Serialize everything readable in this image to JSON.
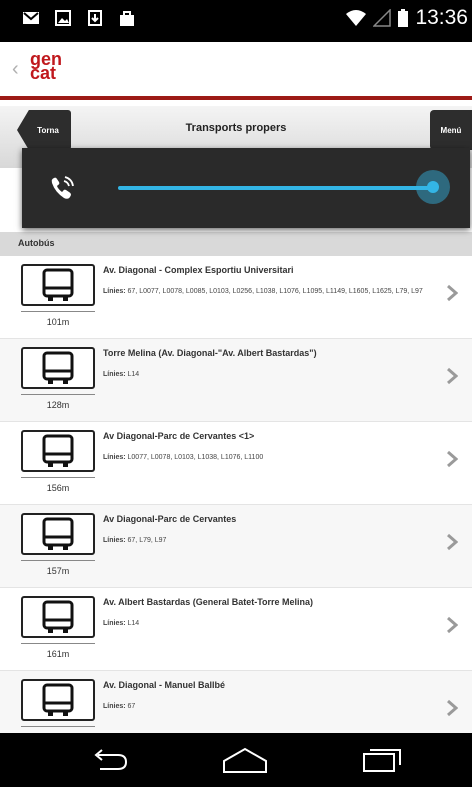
{
  "status_bar": {
    "time": "13:36",
    "left_icons": [
      "gmail-icon",
      "image-icon",
      "download-icon",
      "shopping-bag-icon"
    ],
    "right_icons": [
      "wifi-icon",
      "signal-icon",
      "battery-icon"
    ]
  },
  "header": {
    "logo_top": "gen",
    "logo_bottom": "cat"
  },
  "navbar": {
    "back_label": "Torna",
    "title": "Transports propers",
    "menu_label": "Menú"
  },
  "volume": {
    "level": 1.0,
    "icon": "phone-in-call-icon"
  },
  "section": {
    "title": "Autobús"
  },
  "stops": [
    {
      "name": "Av. Diagonal - Complex Esportiu Universitari",
      "lines_label": "Línies:",
      "lines": "67, L0077, L0078, L0085, L0103, L0256, L1038, L1076, L1095, L1149, L1605, L1625, L79, L97",
      "distance": "101m"
    },
    {
      "name": "Torre Melina (Av. Diagonal-\"Av. Albert Bastardas\")",
      "lines_label": "Línies:",
      "lines": "L14",
      "distance": "128m"
    },
    {
      "name": "Av Diagonal-Parc de Cervantes <1>",
      "lines_label": "Línies:",
      "lines": "L0077, L0078, L0103, L1038, L1076, L1100",
      "distance": "156m"
    },
    {
      "name": "Av Diagonal-Parc de Cervantes",
      "lines_label": "Línies:",
      "lines": "67, L79, L97",
      "distance": "157m"
    },
    {
      "name": "Av. Albert Bastardas (General Batet-Torre Melina)",
      "lines_label": "Línies:",
      "lines": "L14",
      "distance": "161m"
    },
    {
      "name": "Av. Diagonal - Manuel Ballbé",
      "lines_label": "Línies:",
      "lines": "67",
      "distance": ""
    }
  ],
  "colors": {
    "gencat_red": "#c0181d",
    "accent_blue": "#33b5e5"
  }
}
